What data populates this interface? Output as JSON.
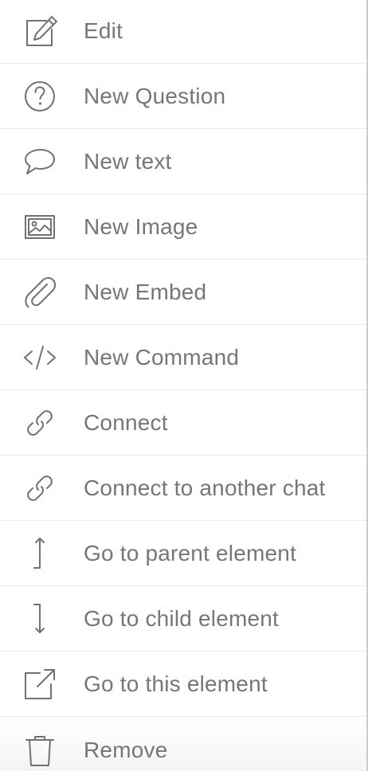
{
  "menu": {
    "items": [
      {
        "label": "Edit",
        "icon": "edit-icon"
      },
      {
        "label": "New Question",
        "icon": "question-icon"
      },
      {
        "label": "New text",
        "icon": "speech-bubble-icon"
      },
      {
        "label": "New Image",
        "icon": "image-icon"
      },
      {
        "label": "New Embed",
        "icon": "paperclip-icon"
      },
      {
        "label": "New Command",
        "icon": "code-icon"
      },
      {
        "label": "Connect",
        "icon": "link-icon"
      },
      {
        "label": "Connect to another chat",
        "icon": "link-icon"
      },
      {
        "label": "Go to parent element",
        "icon": "arrow-up-icon"
      },
      {
        "label": "Go to child element",
        "icon": "arrow-down-icon"
      },
      {
        "label": "Go to this element",
        "icon": "external-link-icon"
      },
      {
        "label": "Remove",
        "icon": "trash-icon"
      }
    ]
  }
}
